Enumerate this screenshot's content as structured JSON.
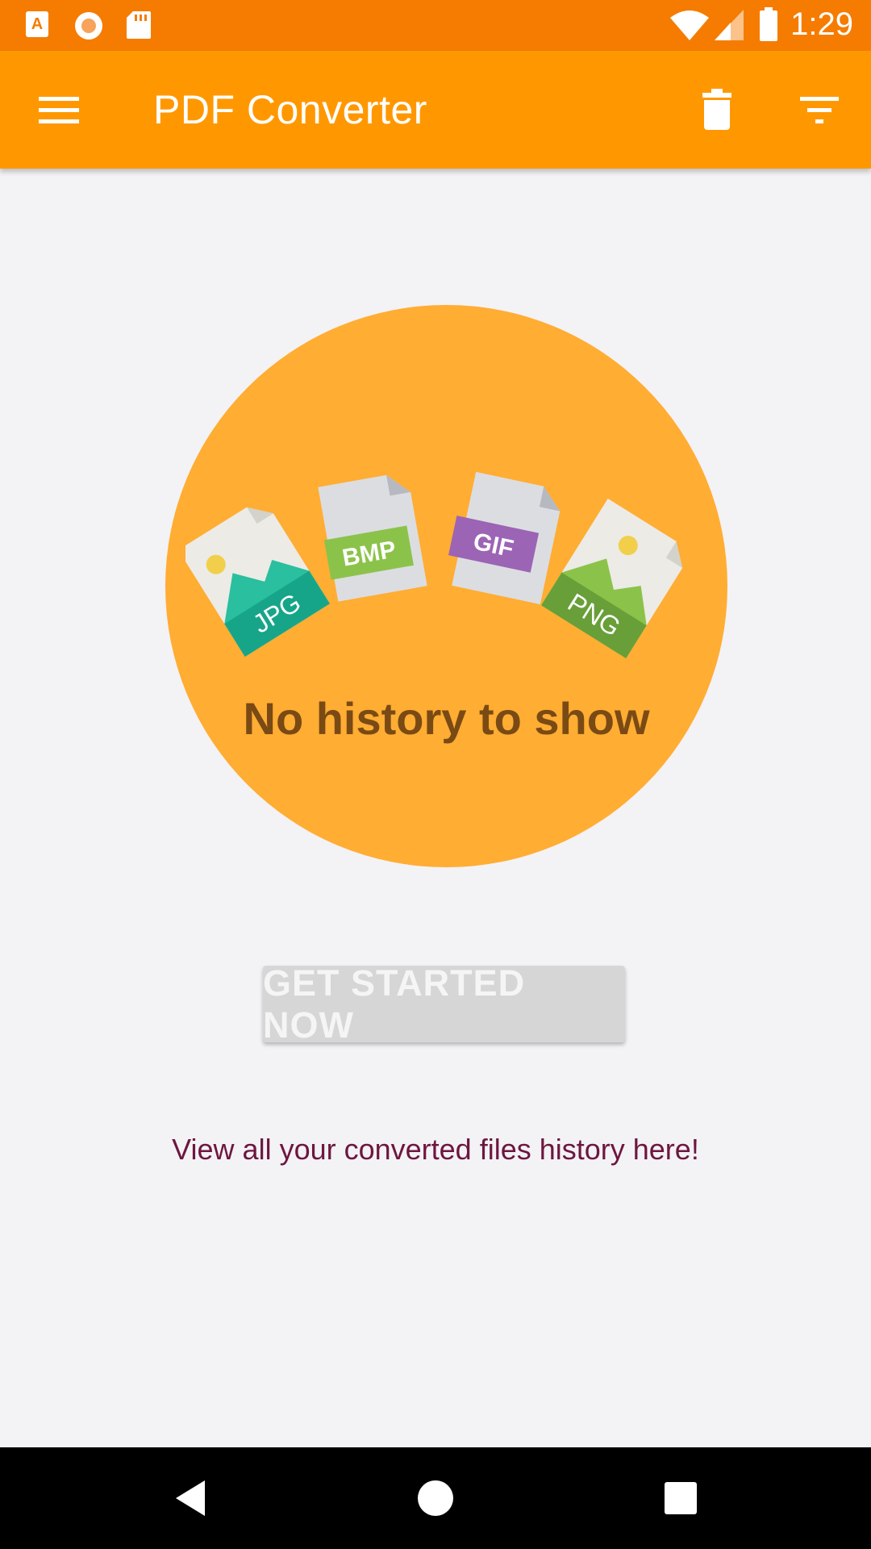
{
  "status_bar": {
    "time": "1:29",
    "left_icons": [
      "text-notification-icon",
      "record-icon",
      "sd-card-icon"
    ],
    "right_icons": [
      "wifi-icon",
      "signal-icon",
      "battery-icon"
    ]
  },
  "app_bar": {
    "title": "PDF Converter",
    "menu_icon": "hamburger-menu-icon",
    "actions": [
      "delete-icon",
      "filter-icon"
    ]
  },
  "empty_state": {
    "title": "No history to show",
    "file_types": [
      "JPG",
      "BMP",
      "GIF",
      "PNG"
    ],
    "button_label": "GET STARTED NOW",
    "hint": "View all your converted files history here!"
  },
  "colors": {
    "status_bar": "#f57c00",
    "app_bar": "#ff9800",
    "circle": "#ffad33",
    "empty_title": "#7a4a14",
    "hint_text": "#6d1640",
    "button_bg": "#d6d6d6"
  },
  "nav_bar": [
    "back-icon",
    "home-icon",
    "recents-icon"
  ]
}
